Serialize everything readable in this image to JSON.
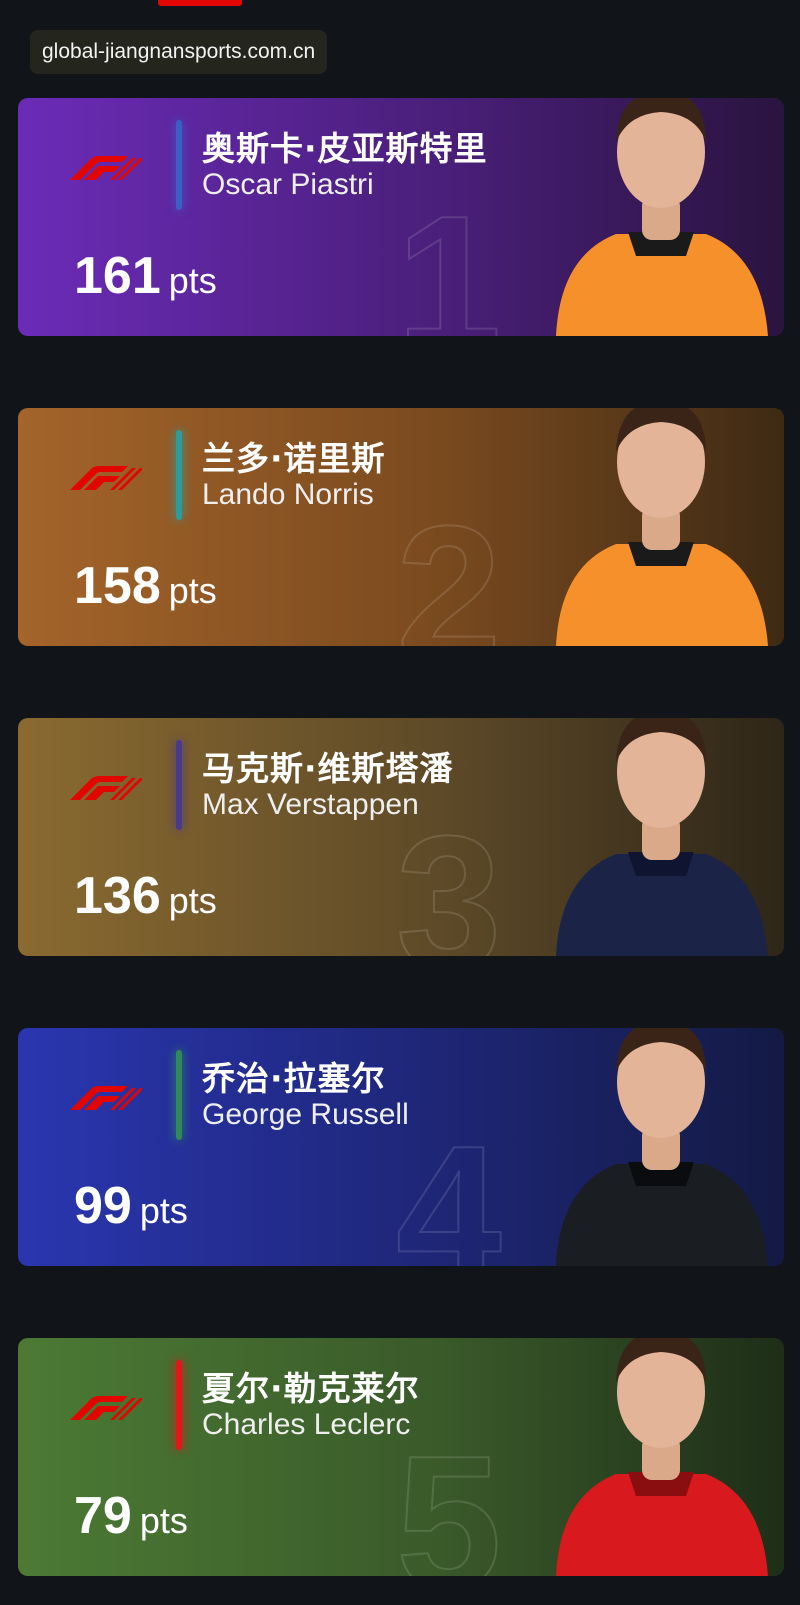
{
  "watermark": {
    "text": "global-jiangnansports.com.cn"
  },
  "points_unit": "pts",
  "drivers": [
    {
      "rank": "1",
      "name_zh": "奥斯卡·皮亚斯特里",
      "name_en": "Oscar Piastri",
      "points": "161",
      "accent": "#3b5fc7",
      "suit": "#f5902a",
      "suit_dark": "#1a1a1a"
    },
    {
      "rank": "2",
      "name_zh": "兰多·诺里斯",
      "name_en": "Lando Norris",
      "points": "158",
      "accent": "#2e9c9a",
      "suit": "#f5902a",
      "suit_dark": "#1a1a1a"
    },
    {
      "rank": "3",
      "name_zh": "马克斯·维斯塔潘",
      "name_en": "Max Verstappen",
      "points": "136",
      "accent": "#4a3a8a",
      "suit": "#1b2447",
      "suit_dark": "#0f1530"
    },
    {
      "rank": "4",
      "name_zh": "乔治·拉塞尔",
      "name_en": "George Russell",
      "points": "99",
      "accent": "#2f8a5a",
      "suit": "#1a1d22",
      "suit_dark": "#0a0c10"
    },
    {
      "rank": "5",
      "name_zh": "夏尔·勒克莱尔",
      "name_en": "Charles Leclerc",
      "points": "79",
      "accent": "#e01818",
      "suit": "#d8191e",
      "suit_dark": "#8a0d10"
    }
  ],
  "icons": {
    "f1_logo": "f1-logo-icon"
  },
  "colors": {
    "f1_red": "#e10600"
  }
}
